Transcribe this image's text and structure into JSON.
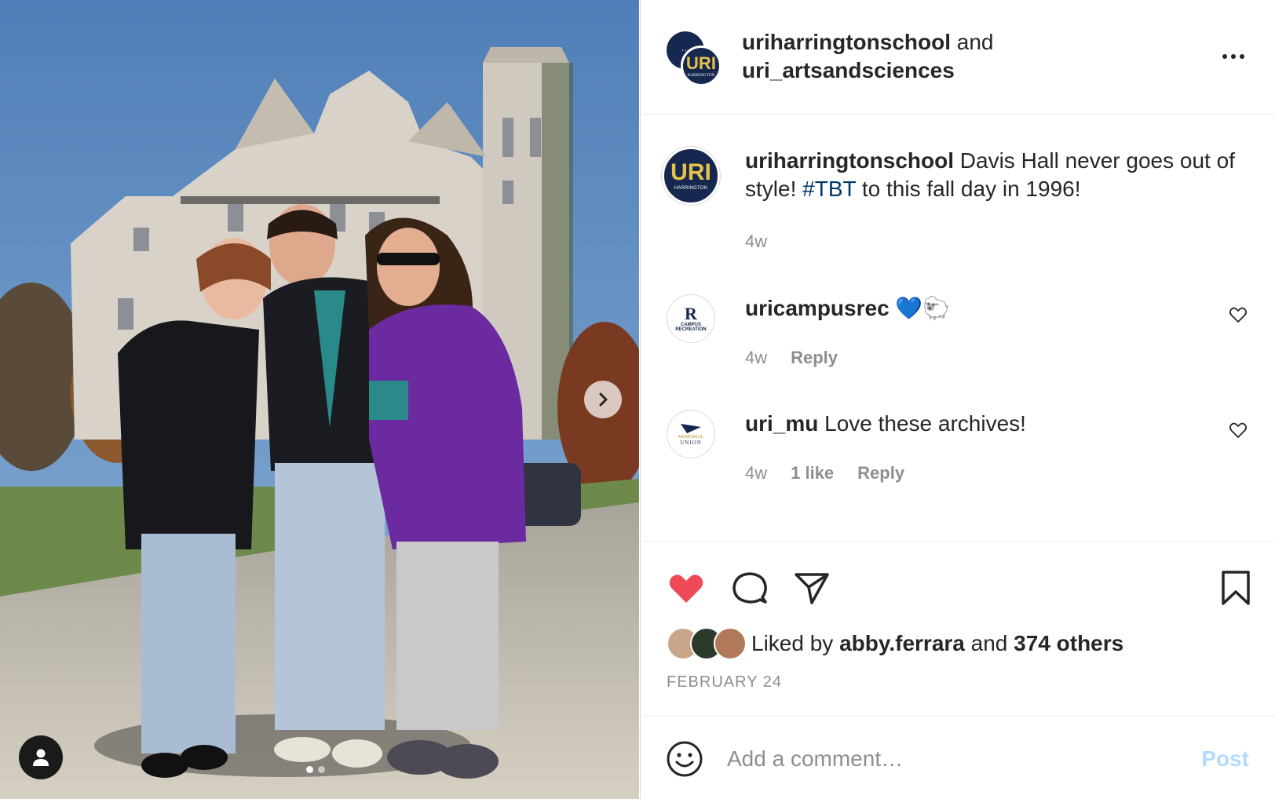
{
  "header": {
    "account_1": "uriharringtonschool",
    "connector": "and",
    "account_2": "uri_artsandsciences",
    "avatar_text": "URI",
    "avatar_sub": "HARRINGTON",
    "more_icon": "more-horizontal-icon"
  },
  "caption": {
    "username": "uriharringtonschool",
    "text_before": "Davis Hall never goes out of style!",
    "hashtag": "#TBT",
    "text_after": "to this fall day in 1996!",
    "time": "4w",
    "avatar_text": "URI",
    "avatar_sub": "HARRINGTON"
  },
  "comments": [
    {
      "username": "uricampusrec",
      "text": "💙🐑",
      "time": "4w",
      "likes": "",
      "reply": "Reply",
      "avatar_line1": "CAMPUS",
      "avatar_line2": "RECREATION"
    },
    {
      "username": "uri_mu",
      "text": "Love these archives!",
      "time": "4w",
      "likes": "1 like",
      "reply": "Reply",
      "avatar_line1": "MEMORIAL",
      "avatar_line2": "UNION"
    }
  ],
  "actions": {
    "liked": true,
    "liked_by_prefix": "Liked by",
    "liked_by_user": "abby.ferrara",
    "liked_by_and": "and",
    "liked_by_others": "374 others",
    "date": "FEBRUARY 24"
  },
  "add_comment": {
    "placeholder": "Add a comment…",
    "post_label": "Post"
  },
  "carousel": {
    "slides": 2,
    "current": 1
  },
  "colors": {
    "like_red": "#ed4956",
    "hashtag_blue": "#00376b",
    "post_disabled": "#b3dbff",
    "uri_navy": "#16284f",
    "uri_gold": "#e7c24a"
  }
}
